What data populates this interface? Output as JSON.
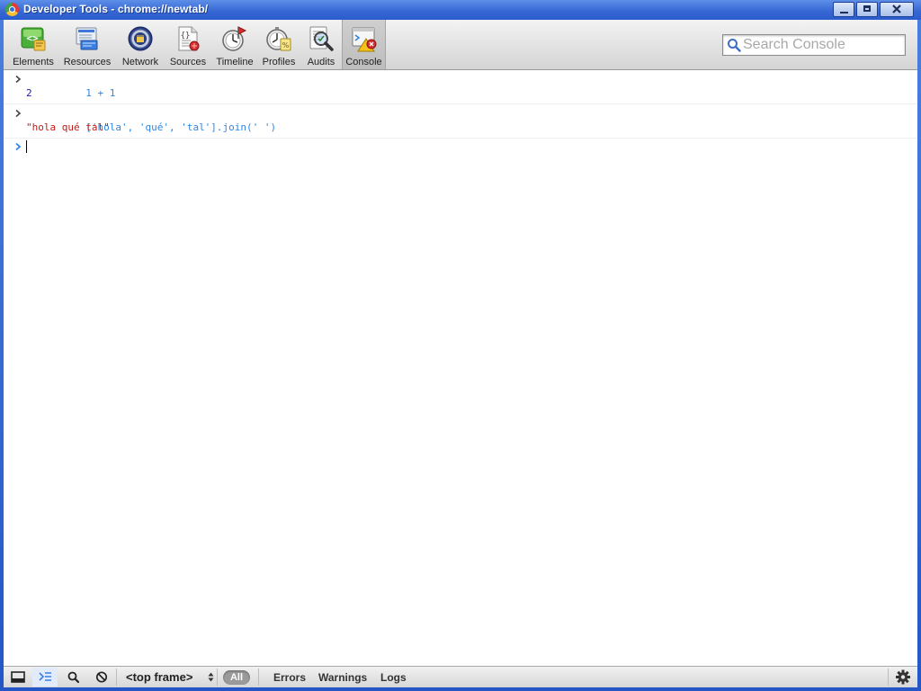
{
  "window": {
    "title": "Developer Tools - chrome://newtab/",
    "controls": [
      "minimize",
      "maximize",
      "close"
    ]
  },
  "toolbar": {
    "panels": [
      {
        "label": "Elements",
        "icon": "elements-icon"
      },
      {
        "label": "Resources",
        "icon": "resources-icon"
      },
      {
        "label": "Network",
        "icon": "network-icon"
      },
      {
        "label": "Sources",
        "icon": "sources-icon"
      },
      {
        "label": "Timeline",
        "icon": "timeline-icon"
      },
      {
        "label": "Profiles",
        "icon": "profiles-icon"
      },
      {
        "label": "Audits",
        "icon": "audits-icon"
      },
      {
        "label": "Console",
        "icon": "console-icon",
        "selected": true
      }
    ],
    "search_placeholder": "Search Console"
  },
  "console": {
    "entries": [
      {
        "command": "1 + 1",
        "result": "2",
        "result_type": "number"
      },
      {
        "command": "['hola', 'qué', 'tal'].join(' ')",
        "result": "\"hola qué tal\"",
        "result_type": "string"
      }
    ],
    "prompt_value": ""
  },
  "statusbar": {
    "frame_selector": "<top frame>",
    "filters": {
      "all": "All",
      "errors": "Errors",
      "warnings": "Warnings",
      "logs": "Logs"
    }
  },
  "colors": {
    "command": "#2f87e3",
    "number_result": "#1a1aa6",
    "string_result": "#c41a16",
    "titlebar": "#3566d3"
  }
}
